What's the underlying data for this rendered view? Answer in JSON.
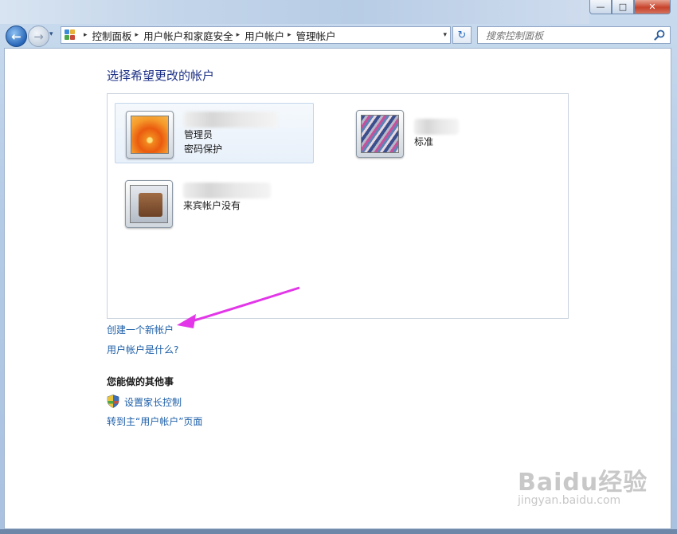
{
  "window": {
    "minimize_glyph": "—",
    "maximize_glyph": "□",
    "close_glyph": "✕"
  },
  "nav": {
    "back_glyph": "←",
    "forward_glyph": "→",
    "dropdown_glyph": "▾",
    "breadcrumbs": [
      "控制面板",
      "用户帐户和家庭安全",
      "用户帐户",
      "管理帐户"
    ],
    "crumb_separator": "▸",
    "refresh_glyph": "↻",
    "search_placeholder": "搜索控制面板"
  },
  "main": {
    "title": "选择希望更改的帐户",
    "accounts": [
      {
        "picture": "flower-picture",
        "type_lines": [
          "管理员",
          "密码保护"
        ]
      },
      {
        "picture": "fabric-picture",
        "type_lines": [
          "标准"
        ]
      },
      {
        "picture": "luggage-picture",
        "type_lines": [
          "来宾帐户没有"
        ]
      }
    ],
    "links": {
      "create_account": "创建一个新帐户",
      "what_is_account": "用户帐户是什么?"
    },
    "other_section": {
      "heading": "您能做的其他事",
      "parental_controls": "设置家长控制",
      "goto_main": "转到主“用户帐户”页面"
    }
  },
  "annotation": {
    "arrow_color": "#e236e8"
  },
  "watermark": {
    "logo": "Baidu经验",
    "url": "jingyan.baidu.com"
  },
  "icons": [
    "control-panel-icon",
    "search-icon",
    "shield-icon",
    "refresh-icon"
  ]
}
